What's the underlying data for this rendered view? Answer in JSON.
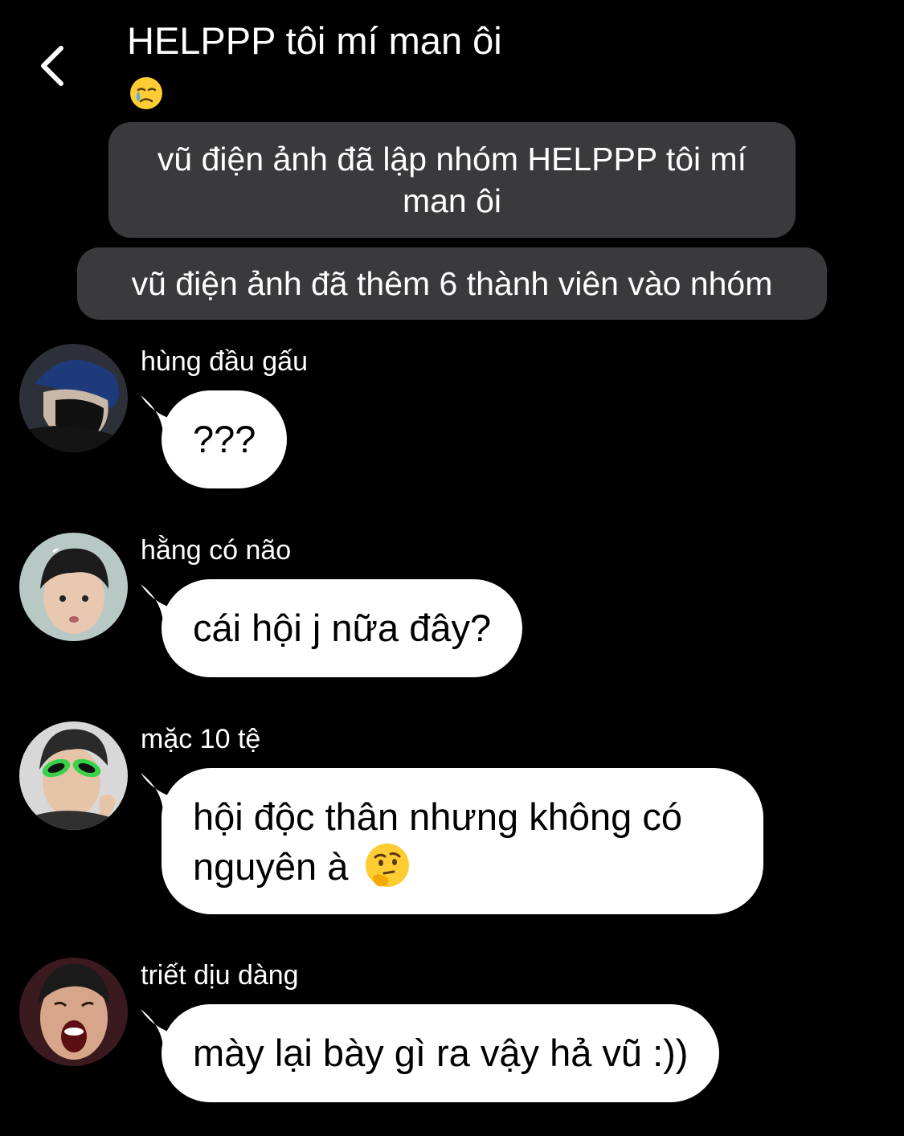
{
  "header": {
    "back_icon": "chevron-left-icon",
    "title": "HELPPP tôi mí man ôi",
    "title_emoji": "crying-face-emoji"
  },
  "system_messages": [
    "vũ điện ảnh đã lập nhóm HELPPP tôi mí man ôi",
    "vũ điện ảnh đã thêm 6 thành viên vào nhóm"
  ],
  "messages": [
    {
      "sender": "hùng đầu gấu",
      "text": "???"
    },
    {
      "sender": "hằng có não",
      "text": "cái hội j nữa đây?"
    },
    {
      "sender": "mặc 10 tệ",
      "text": "hội độc thân nhưng không có nguyên à",
      "emoji": "thinking-face-emoji"
    },
    {
      "sender": "triết dịu dàng",
      "text": "mày lại bày gì ra vậy hả vũ :))"
    }
  ],
  "colors": {
    "background": "#000000",
    "system_bubble": "#3a3a3c",
    "message_bubble": "#ffffff",
    "message_text": "#000000"
  }
}
